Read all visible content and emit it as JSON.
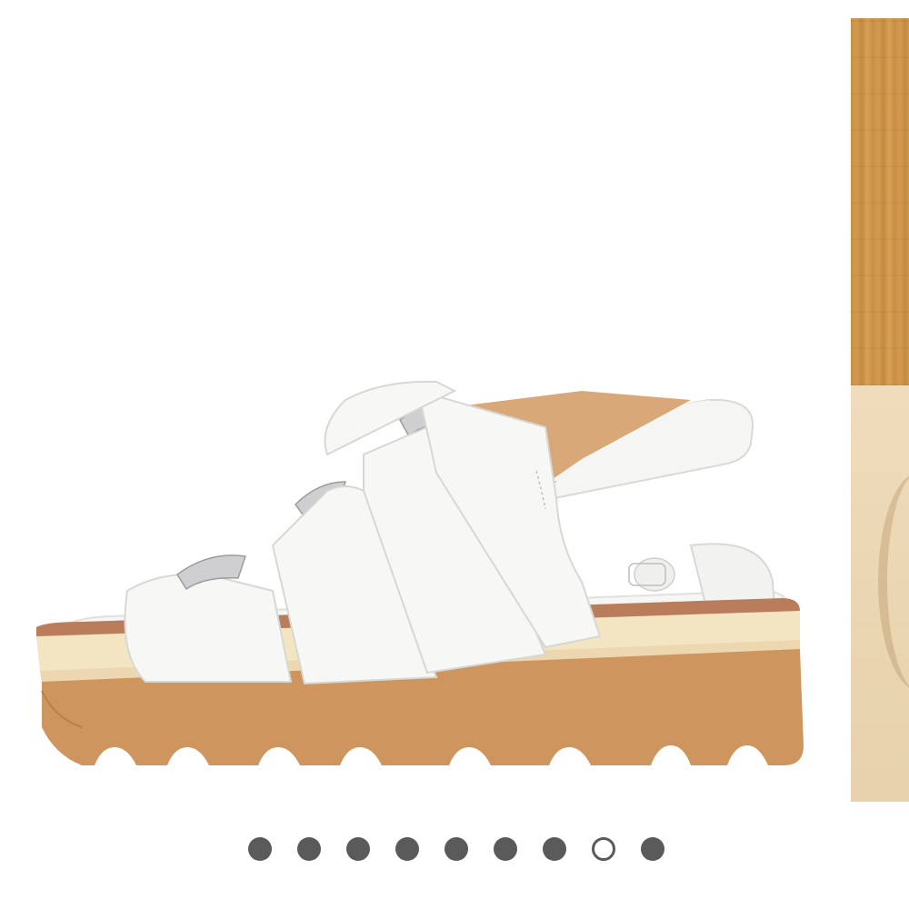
{
  "carousel": {
    "total_slides": 9,
    "active_index": 7,
    "dot_color": "#5a5a5a",
    "active_dot_fill": "#ffffff",
    "main_image": "white-fisherman-platform-sandal-side-view",
    "next_image_peek": "wood-floor-and-cream-backdrop"
  },
  "colors": {
    "background": "#ffffff",
    "sandal_upper": "#f7f7f5",
    "sole_tan": "#cf955e",
    "sole_cream_stripe": "#f3e4c2",
    "welt_brown": "#b97d5c"
  }
}
